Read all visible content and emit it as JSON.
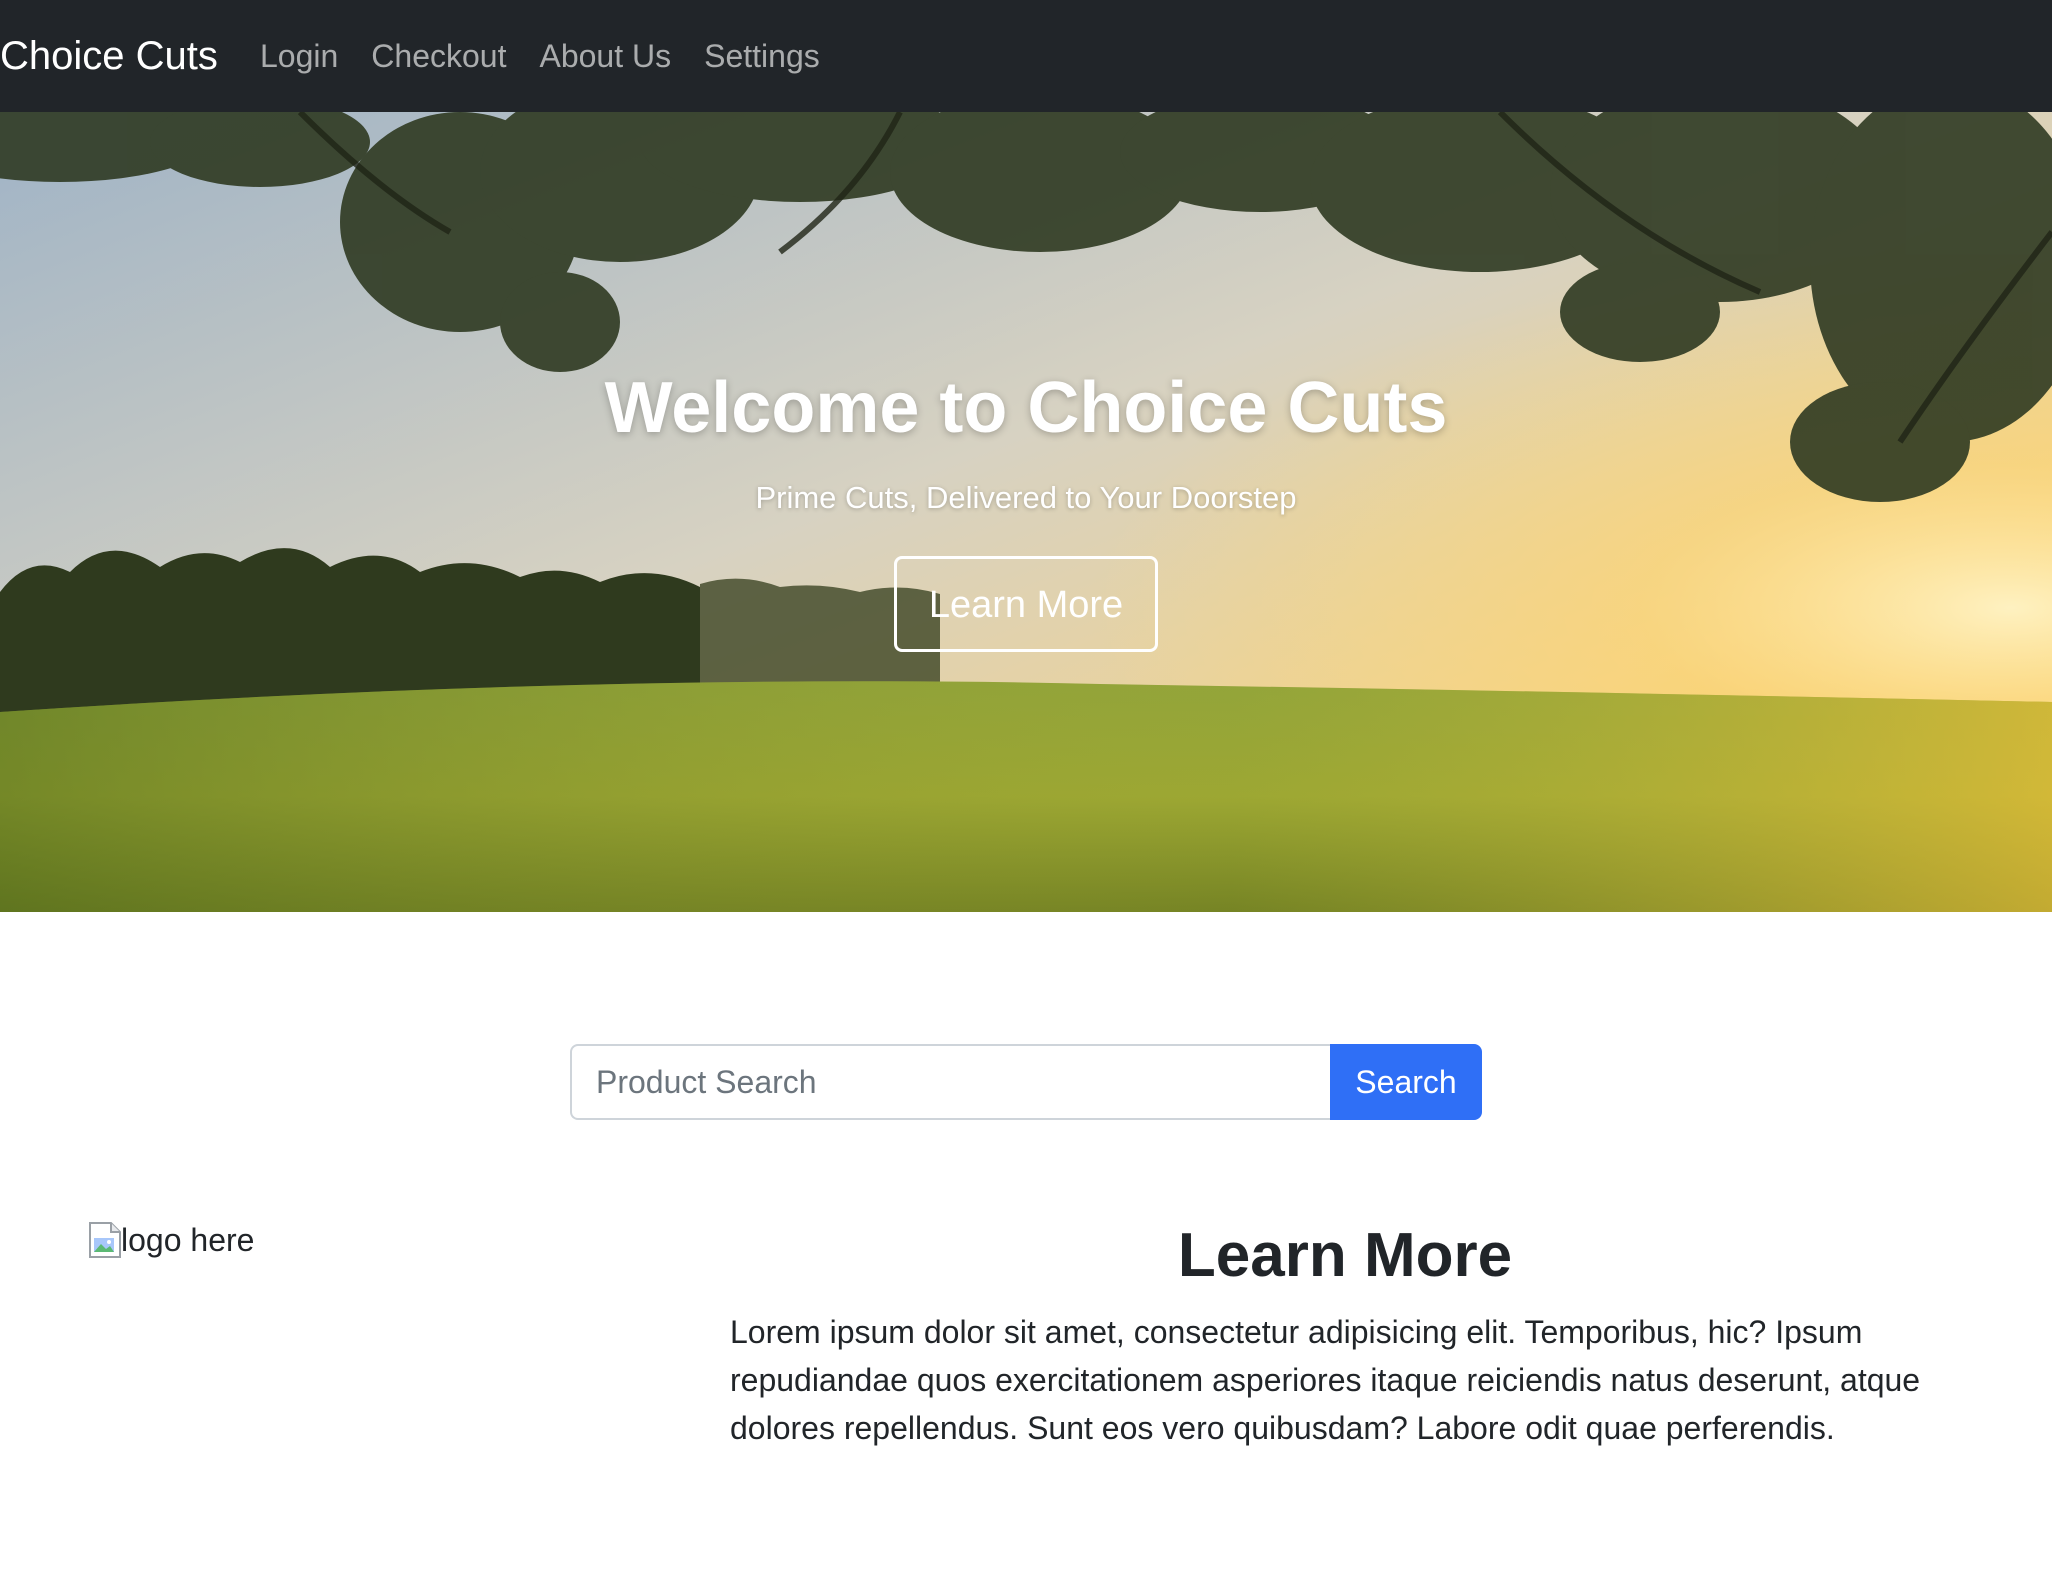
{
  "navbar": {
    "brand": "Choice Cuts",
    "links": [
      "Login",
      "Checkout",
      "About Us",
      "Settings"
    ]
  },
  "hero": {
    "title": "Welcome to Choice Cuts",
    "subtitle": "Prime Cuts, Delivered to Your Doorstep",
    "button_label": "Learn More"
  },
  "search": {
    "placeholder": "Product Search",
    "button_label": "Search"
  },
  "logo": {
    "alt_text": "logo here"
  },
  "learn_more": {
    "heading": "Learn More",
    "body": "Lorem ipsum dolor sit amet, consectetur adipisicing elit. Temporibus, hic? Ipsum repudiandae quos exercitationem asperiores itaque reiciendis natus deserunt, atque dolores repellendus. Sunt eos vero quibusdam? Labore odit quae perferendis."
  },
  "colors": {
    "navbar_bg": "#212529",
    "primary_button": "#2f6ff6"
  }
}
